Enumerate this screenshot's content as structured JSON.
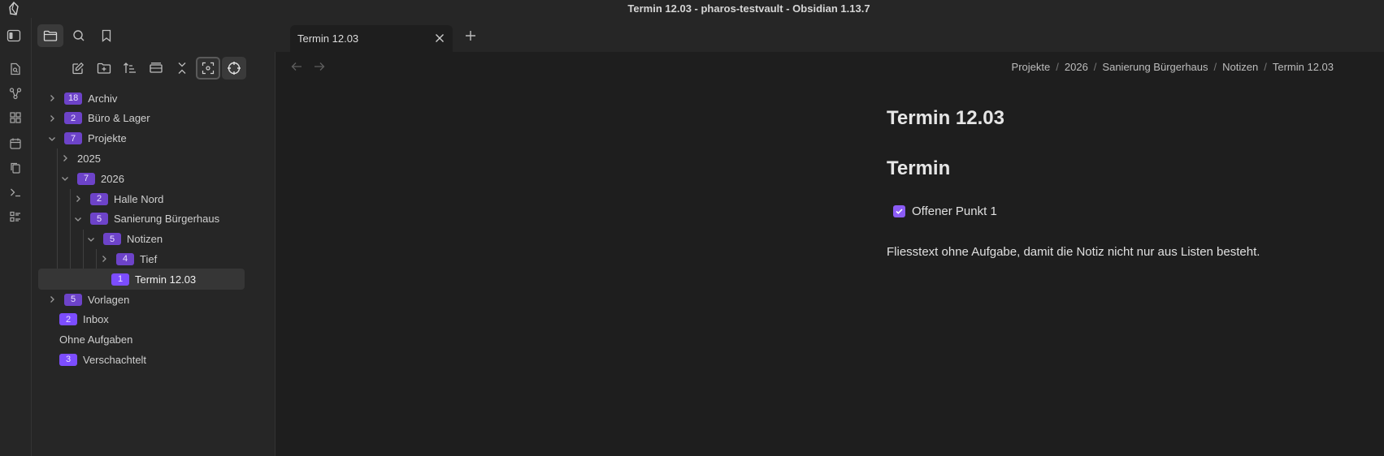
{
  "window": {
    "title": "Termin 12.03 - pharos-testvault - Obsidian 1.13.7"
  },
  "ribbon": {
    "icons": [
      "file-search-icon",
      "graph-icon",
      "canvas-icon",
      "calendar-icon",
      "copy-icon",
      "terminal-icon",
      "list-icon"
    ]
  },
  "sidebar": {
    "tabs": [
      "files-tab",
      "search-tab",
      "bookmarks-tab"
    ],
    "actions": [
      "new-note",
      "new-folder",
      "sort",
      "auto-reveal",
      "collapse-all",
      "focus",
      "locate"
    ],
    "tree": [
      {
        "depth": 0,
        "chevron": "right",
        "badge": "18",
        "label": "Archiv"
      },
      {
        "depth": 0,
        "chevron": "right",
        "badge": "2",
        "label": "Büro & Lager"
      },
      {
        "depth": 0,
        "chevron": "down",
        "badge": "7",
        "label": "Projekte"
      },
      {
        "depth": 1,
        "chevron": "right",
        "badge": "",
        "label": "2025"
      },
      {
        "depth": 1,
        "chevron": "down",
        "badge": "7",
        "label": "2026"
      },
      {
        "depth": 2,
        "chevron": "right",
        "badge": "2",
        "label": "Halle Nord"
      },
      {
        "depth": 2,
        "chevron": "down",
        "badge": "5",
        "label": "Sanierung Bürgerhaus"
      },
      {
        "depth": 3,
        "chevron": "down",
        "badge": "5",
        "label": "Notizen"
      },
      {
        "depth": 4,
        "chevron": "right",
        "badge": "4",
        "label": "Tief"
      },
      {
        "depth": 4,
        "chevron": "",
        "badge": "1",
        "label": "Termin 12.03",
        "selected": true
      },
      {
        "depth": 0,
        "chevron": "right",
        "badge": "5",
        "label": "Vorlagen"
      },
      {
        "depth": 0,
        "chevron": "",
        "badge": "2",
        "label": "Inbox"
      },
      {
        "depth": 0,
        "chevron": "",
        "badge": "",
        "label": "Ohne Aufgaben"
      },
      {
        "depth": 0,
        "chevron": "",
        "badge": "3",
        "label": "Verschachtelt"
      }
    ]
  },
  "tabs": {
    "active_title": "Termin 12.03"
  },
  "breadcrumb": [
    "Projekte",
    "2026",
    "Sanierung Bürgerhaus",
    "Notizen",
    "Termin 12.03"
  ],
  "note": {
    "title": "Termin 12.03",
    "heading": "Termin",
    "task": "Offener Punkt 1",
    "task_checked": true,
    "paragraph": "Fliesstext ohne Aufgabe, damit die Notiz nicht nur aus Listen besteht."
  },
  "colors": {
    "accent": "#8b5cf6",
    "badge": "#6d43c9",
    "background": "#1e1e1e",
    "panel": "#262626"
  }
}
